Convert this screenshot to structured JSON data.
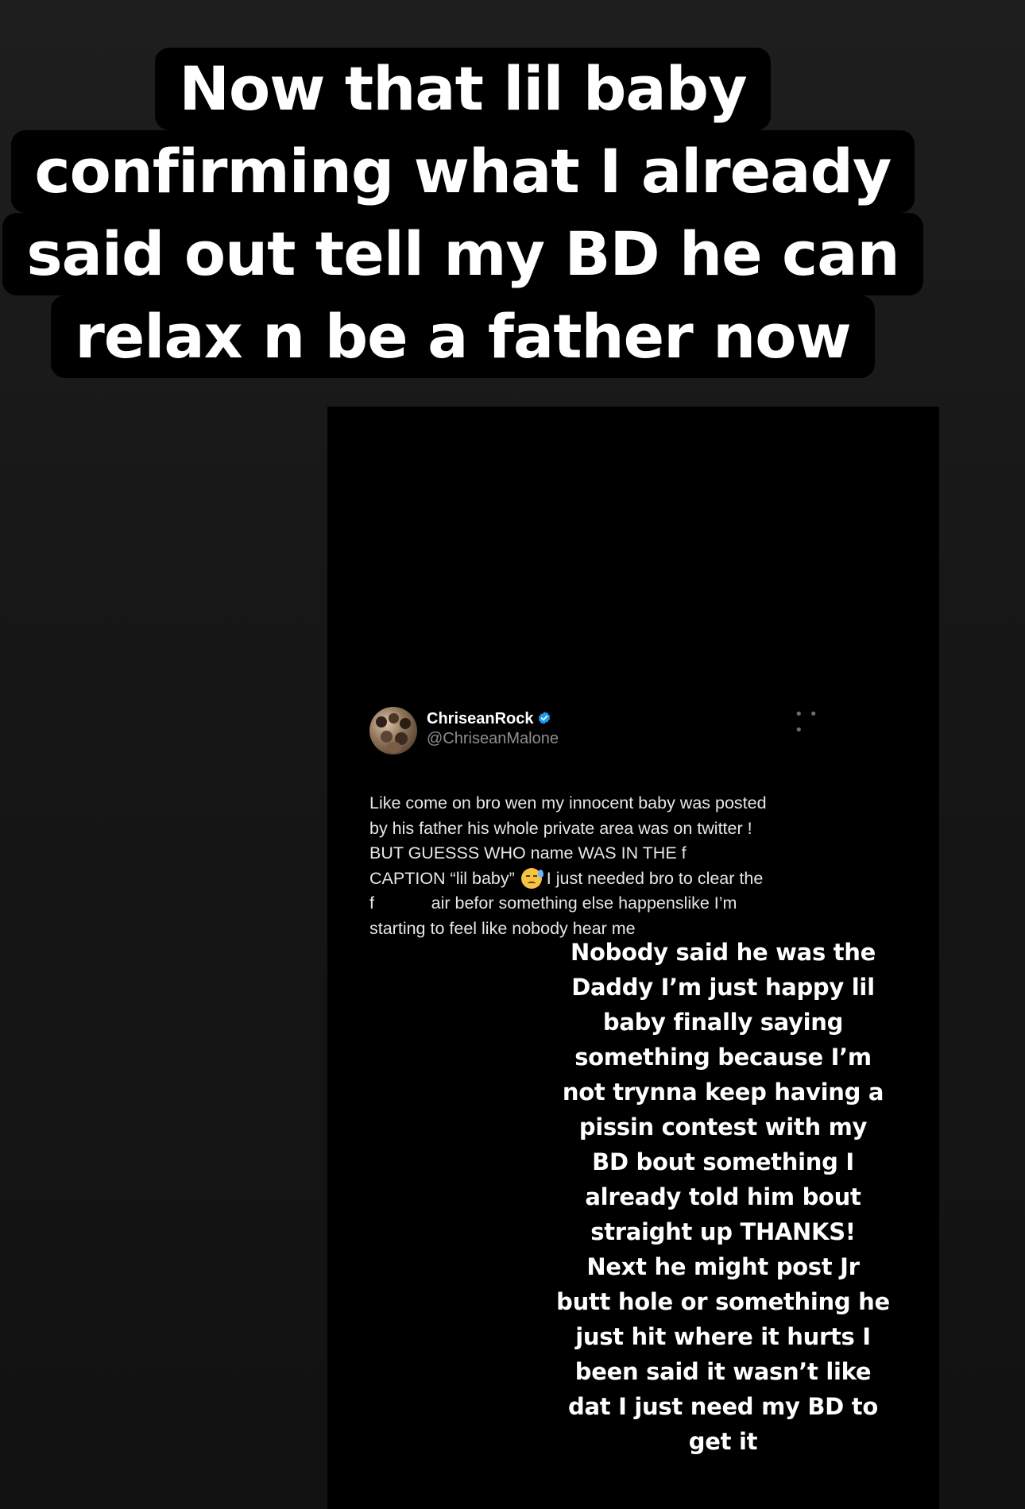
{
  "caption": {
    "lines": [
      "Now that lil baby",
      "confirming what I already",
      "said out tell my BD he can",
      "relax n be a father now"
    ]
  },
  "tweet": {
    "name": "ChriseanRock",
    "handle": "@ChriseanMalone",
    "more_icon": "more-horizontal-icon",
    "verified_icon": "verified-badge-icon",
    "verified_color": "#1d9bf0",
    "emoji_icon": "anxious-face-with-sweat-emoji",
    "body_lines": [
      "Like come on bro wen my innocent baby was posted",
      "by his father his whole private area was on twitter !",
      "BUT GUESSS WHO name WAS IN THE f",
      "CAPTION “lil baby”",
      "I just needed bro to clear the",
      "f            air befor something else happenslike I’m",
      "starting to feel like nobody hear me"
    ]
  },
  "story_text": {
    "lines": [
      "Nobody said he was the",
      "Daddy I’m just happy lil",
      "baby finally saying",
      "something because I’m",
      "not trynna keep having a",
      "pissin contest  with my",
      "BD bout something I",
      "already told him bout",
      "straight up THANKS!",
      "Next he might post Jr",
      "butt hole or something he",
      "just hit where it hurts  I",
      "been said it wasn’t like",
      "dat I just need my BD to",
      "get it"
    ]
  },
  "colors": {
    "background": "#1a1a1a",
    "caption_bg": "#000000",
    "panel_bg": "#000000",
    "text": "#ffffff",
    "handle": "#8b8f94"
  }
}
